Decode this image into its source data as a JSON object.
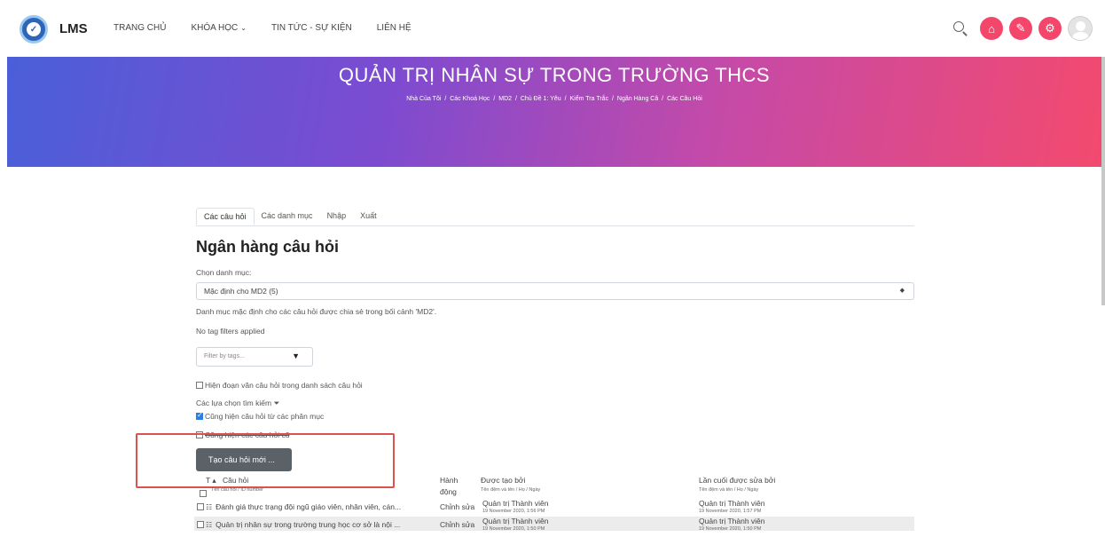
{
  "nav": {
    "brand": "LMS",
    "items": [
      "TRANG CHỦ",
      "KHÓA HỌC",
      "TIN TỨC - SỰ KIỆN",
      "LIÊN HỆ"
    ]
  },
  "banner": {
    "title": "QUẢN TRỊ NHÂN SỰ TRONG TRƯỜNG THCS",
    "breadcrumbs": [
      "Nhà Của Tôi",
      "Các Khoá Học",
      "MD2",
      "Chủ Đề 1: Yêu",
      "Kiểm Tra Trắc",
      "Ngân Hàng Câ",
      "Các Câu Hỏi"
    ]
  },
  "tabs": [
    "Các câu hỏi",
    "Các danh mục",
    "Nhập",
    "Xuất"
  ],
  "heading": "Ngân hàng câu hỏi",
  "category": {
    "label": "Chọn danh mục:",
    "value": "Mặc định cho MD2 (5)",
    "description": "Danh mục mặc định cho các câu hỏi được chia sẻ trong bối cảnh 'MD2'."
  },
  "tag_status": "No tag filters applied",
  "filter_placeholder": "Filter by tags...",
  "options": {
    "show_text": "Hiện đoạn văn câu hỏi trong danh sách câu hỏi",
    "search_options": "Các lựa chọn tìm kiếm",
    "subcategories": "Cũng hiện câu hỏi từ các phân mục",
    "old_questions": "Cũng hiện các câu hỏi cũ"
  },
  "create_button": "Tạo câu hỏi mới ...",
  "table": {
    "col_type": "T",
    "col_question": "Câu hỏi",
    "col_question_sub": "Tên câu hỏi / ID number",
    "col_action_1": "Hành",
    "col_action_2": "động",
    "col_created": "Được tạo bởi",
    "col_created_sub": "Tên đệm và tên / Họ / Ngày",
    "col_modified": "Lần cuối được sửa bởi",
    "col_modified_sub": "Tên đệm và tên / Họ / Ngày",
    "rows": [
      {
        "question": "Đánh giá thực trạng đội ngũ giáo viên, nhân viên, cán...",
        "action": "Chỉnh sửa",
        "created_by": "Quản trị Thành viên",
        "created_date": "19 November 2020, 1:56 PM",
        "modified_by": "Quản trị Thành viên",
        "modified_date": "19 November 2020, 1:57 PM"
      },
      {
        "question": "Quản trị nhân sự trong trường trung học cơ sở là nội ...",
        "action": "Chỉnh sửa",
        "created_by": "Quản trị Thành viên",
        "created_date": "19 November 2020, 1:50 PM",
        "modified_by": "Quản trị Thành viên",
        "modified_date": "19 November 2020, 1:50 PM"
      }
    ]
  }
}
